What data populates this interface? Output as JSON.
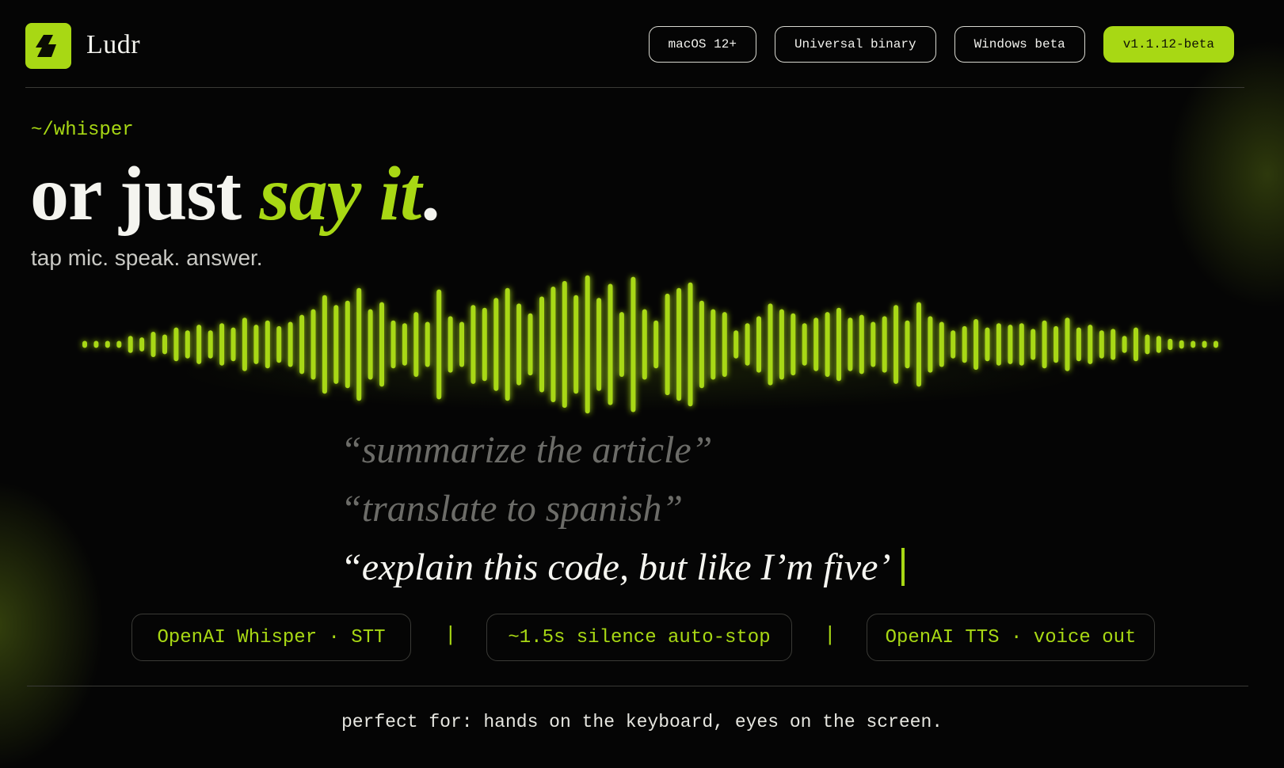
{
  "brand": {
    "name": "Ludr",
    "logo_icon": "lightning-bolt-icon",
    "accent": "#a8d814"
  },
  "badges": [
    {
      "label": "macOS 12+",
      "accent": false
    },
    {
      "label": "Universal binary",
      "accent": false
    },
    {
      "label": "Windows beta",
      "accent": false
    },
    {
      "label": "v1.1.12-beta",
      "accent": true
    }
  ],
  "hero": {
    "path": "~/whisper",
    "headline_plain": "or just ",
    "headline_highlight": "say it",
    "headline_end": ".",
    "subline": "tap mic. speak. answer."
  },
  "waveform": {
    "levels": [
      0.05,
      0.05,
      0.05,
      0.05,
      0.12,
      0.1,
      0.18,
      0.14,
      0.24,
      0.2,
      0.28,
      0.2,
      0.3,
      0.24,
      0.38,
      0.28,
      0.34,
      0.26,
      0.32,
      0.42,
      0.5,
      0.7,
      0.56,
      0.62,
      0.8,
      0.5,
      0.6,
      0.34,
      0.3,
      0.46,
      0.32,
      0.78,
      0.4,
      0.32,
      0.56,
      0.52,
      0.66,
      0.8,
      0.58,
      0.44,
      0.68,
      0.82,
      0.9,
      0.7,
      0.98,
      0.66,
      0.86,
      0.46,
      0.96,
      0.5,
      0.34,
      0.72,
      0.8,
      0.88,
      0.62,
      0.5,
      0.46,
      0.2,
      0.3,
      0.4,
      0.58,
      0.5,
      0.44,
      0.3,
      0.38,
      0.46,
      0.52,
      0.38,
      0.42,
      0.32,
      0.4,
      0.56,
      0.34,
      0.6,
      0.4,
      0.32,
      0.2,
      0.26,
      0.36,
      0.24,
      0.3,
      0.28,
      0.3,
      0.22,
      0.34,
      0.26,
      0.38,
      0.24,
      0.28,
      0.2,
      0.22,
      0.12,
      0.24,
      0.14,
      0.12,
      0.08,
      0.06,
      0.05,
      0.05,
      0.05
    ]
  },
  "prompts": [
    {
      "text": "“summarize the article”",
      "active": false
    },
    {
      "text": "“translate to spanish”",
      "active": false
    },
    {
      "text": "“explain this code, but like I’m five’",
      "active": true
    }
  ],
  "features": [
    {
      "label": "OpenAI Whisper · STT"
    },
    {
      "label": "~1.5s silence auto-stop"
    },
    {
      "label": "OpenAI TTS · voice out"
    }
  ],
  "separator": "|",
  "tagline": "perfect for: hands on the keyboard, eyes on the screen."
}
